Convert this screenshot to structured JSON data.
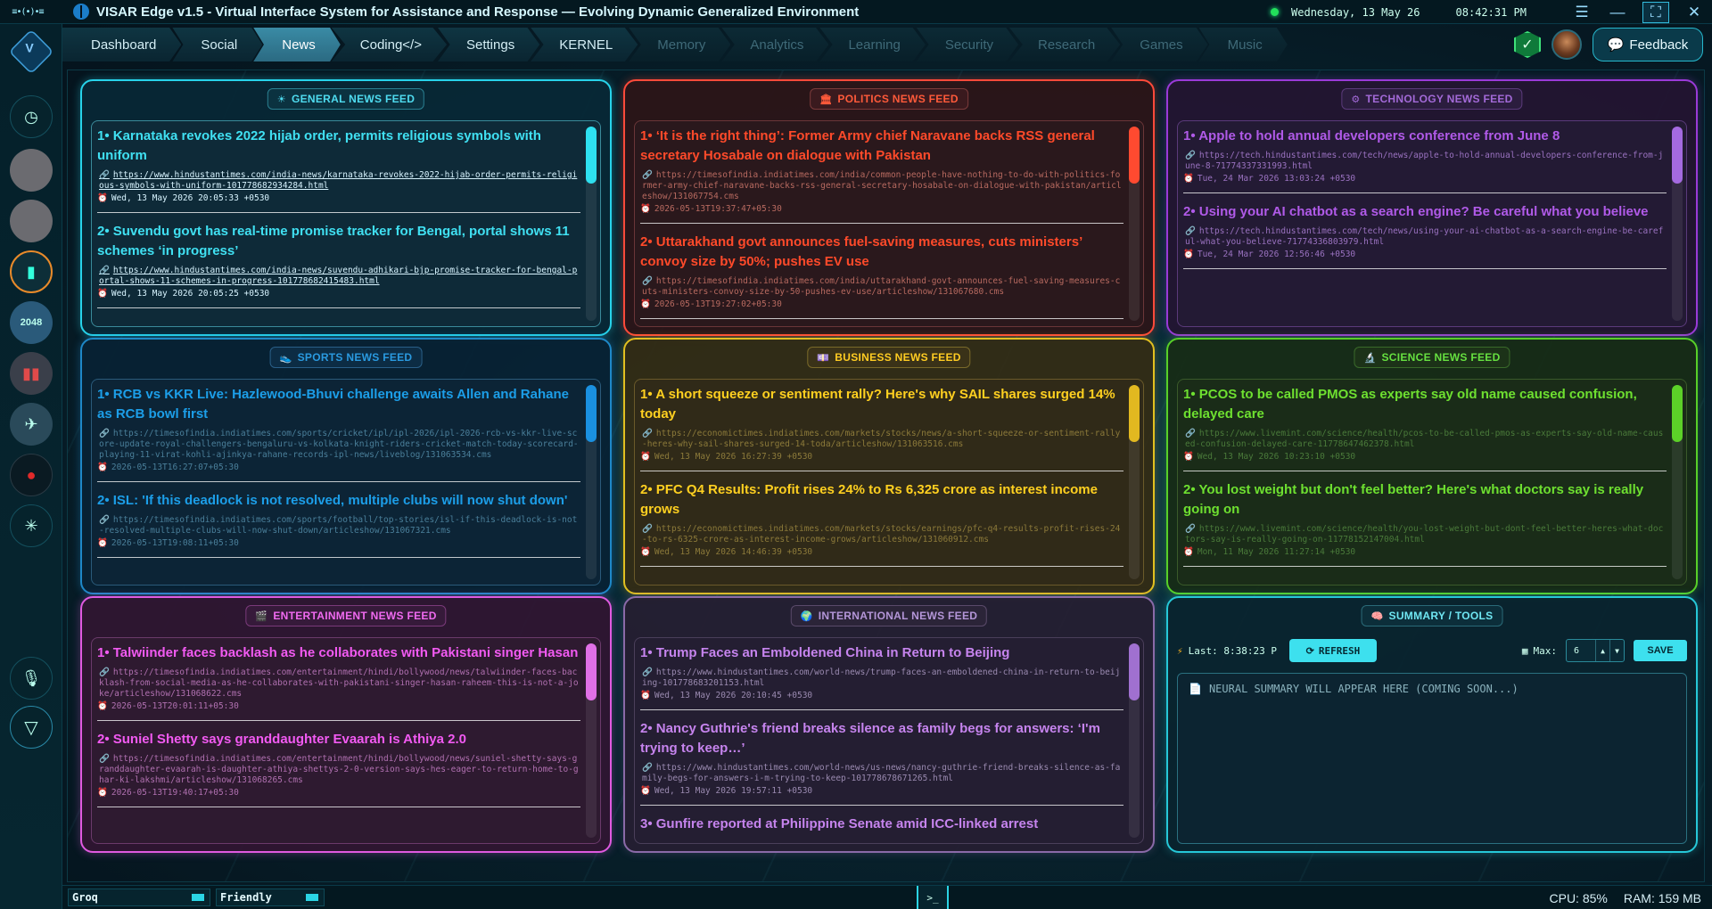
{
  "titlebar": {
    "logo": "≡•(•)•≡",
    "title": "VISAR Edge v1.5 - Virtual Interface System for Assistance and Response — Evolving Dynamic Generalized Environment",
    "date": "Wednesday, 13 May 26",
    "time": "08:42:31 PM"
  },
  "nav": {
    "tabs": [
      {
        "label": "Dashboard"
      },
      {
        "label": "Social"
      },
      {
        "label": "News"
      },
      {
        "label": "Coding</>"
      },
      {
        "label": "Settings"
      },
      {
        "label": "KERNEL"
      },
      {
        "label": "Memory"
      },
      {
        "label": "Analytics"
      },
      {
        "label": "Learning"
      },
      {
        "label": "Security"
      },
      {
        "label": "Research"
      },
      {
        "label": "Games"
      },
      {
        "label": "Music"
      }
    ],
    "active": "News",
    "feedback": "Feedback"
  },
  "feeds": {
    "general": {
      "title": "GENERAL NEWS FEED",
      "icon": "sun-icon",
      "items": [
        {
          "title": "1• Karnataka revokes 2022 hijab order, permits religious symbols with uniform",
          "url": "https://www.hindustantimes.com/india-news/karnataka-revokes-2022-hijab-order-permits-religious-symbols-with-uniform-101778682934284.html",
          "date": "Wed, 13 May 2026 20:05:33 +0530"
        },
        {
          "title": "2• Suvendu govt has real-time promise tracker for Bengal, portal shows 11 schemes ‘in progress’",
          "url": "https://www.hindustantimes.com/india-news/suvendu-adhikari-bjp-promise-tracker-for-bengal-portal-shows-11-schemes-in-progress-101778682415483.html",
          "date": "Wed, 13 May 2026 20:05:25 +0530"
        }
      ]
    },
    "politics": {
      "title": "POLITICS NEWS FEED",
      "icon": "building-icon",
      "items": [
        {
          "title": "1• ‘It is the right thing’: Former Army chief Naravane backs RSS general secretary Hosabale on dialogue with Pakistan",
          "url": "https://timesofindia.indiatimes.com/india/common-people-have-nothing-to-do-with-politics-former-army-chief-naravane-backs-rss-general-secretary-hosabale-on-dialogue-with-pakistan/articleshow/131067754.cms",
          "date": "2026-05-13T19:37:47+05:30"
        },
        {
          "title": "2• Uttarakhand govt announces fuel-saving measures, cuts ministers’ convoy size by 50%; pushes EV use",
          "url": "https://timesofindia.indiatimes.com/india/uttarakhand-govt-announces-fuel-saving-measures-cuts-ministers-convoy-size-by-50-pushes-ev-use/articleshow/131067680.cms",
          "date": "2026-05-13T19:27:02+05:30"
        }
      ]
    },
    "technology": {
      "title": "TECHNOLOGY NEWS FEED",
      "icon": "gear-icon",
      "items": [
        {
          "title": "1• Apple to hold annual developers conference from June 8",
          "url": "https://tech.hindustantimes.com/tech/news/apple-to-hold-annual-developers-conference-from-june-8-71774337331993.html",
          "date": "Tue, 24 Mar 2026 13:03:24 +0530"
        },
        {
          "title": "2• Using your AI chatbot as a search engine? Be careful what you believe",
          "url": "https://tech.hindustantimes.com/tech/news/using-your-ai-chatbot-as-a-search-engine-be-careful-what-you-believe-71774336803979.html",
          "date": "Tue, 24 Mar 2026 12:56:46 +0530"
        }
      ]
    },
    "sports": {
      "title": "SPORTS NEWS FEED",
      "icon": "shoe-icon",
      "items": [
        {
          "title": "1• RCB vs KKR Live: Hazlewood-Bhuvi challenge awaits Allen and Rahane as RCB bowl first",
          "url": "https://timesofindia.indiatimes.com/sports/cricket/ipl/ipl-2026/ipl-2026-rcb-vs-kkr-live-score-update-royal-challengers-bengaluru-vs-kolkata-knight-riders-cricket-match-today-scorecard-playing-11-virat-kohli-ajinkya-rahane-records-ipl-news/liveblog/131063534.cms",
          "date": "2026-05-13T16:27:07+05:30"
        },
        {
          "title": "2• ISL: 'If this deadlock is not resolved, multiple clubs will now shut down'",
          "url": "https://timesofindia.indiatimes.com/sports/football/top-stories/isl-if-this-deadlock-is-not-resolved-multiple-clubs-will-now-shut-down/articleshow/131067321.cms",
          "date": "2026-05-13T19:08:11+05:30"
        }
      ]
    },
    "business": {
      "title": "BUSINESS NEWS FEED",
      "icon": "money-icon",
      "items": [
        {
          "title": "1• A short squeeze or sentiment rally? Here's why SAIL shares surged 14% today",
          "url": "https://economictimes.indiatimes.com/markets/stocks/news/a-short-squeeze-or-sentiment-rally-heres-why-sail-shares-surged-14-toda/articleshow/131063516.cms",
          "date": "Wed, 13 May 2026 16:27:39 +0530"
        },
        {
          "title": "2• PFC Q4 Results: Profit rises 24% to Rs 6,325 crore as interest income grows",
          "url": "https://economictimes.indiatimes.com/markets/stocks/earnings/pfc-q4-results-profit-rises-24-to-rs-6325-crore-as-interest-income-grows/articleshow/131060912.cms",
          "date": "Wed, 13 May 2026 14:46:39 +0530"
        }
      ]
    },
    "science": {
      "title": "SCIENCE NEWS FEED",
      "icon": "microscope-icon",
      "items": [
        {
          "title": "1• PCOS to be called PMOS as experts say old name caused confusion, delayed care",
          "url": "https://www.livemint.com/science/health/pcos-to-be-called-pmos-as-experts-say-old-name-caused-confusion-delayed-care-11778647462378.html",
          "date": "Wed, 13 May 2026 10:23:10 +0530"
        },
        {
          "title": "2• You lost weight but don't feel better? Here's what doctors say is really going on",
          "url": "https://www.livemint.com/science/health/you-lost-weight-but-dont-feel-better-heres-what-doctors-say-is-really-going-on-11778152147004.html",
          "date": "Mon, 11 May 2026 11:27:14 +0530"
        }
      ]
    },
    "entertainment": {
      "title": "ENTERTAINMENT NEWS FEED",
      "icon": "film-icon",
      "items": [
        {
          "title": "1• Talwiinder faces backlash as he collaborates with Pakistani singer Hasan",
          "url": "https://timesofindia.indiatimes.com/entertainment/hindi/bollywood/news/talwiinder-faces-backlash-from-social-media-as-he-collaborates-with-pakistani-singer-hasan-raheem-this-is-not-a-joke/articleshow/131068622.cms",
          "date": "2026-05-13T20:01:11+05:30"
        },
        {
          "title": "2• Suniel Shetty says granddaughter Evaarah is Athiya 2.0",
          "url": "https://timesofindia.indiatimes.com/entertainment/hindi/bollywood/news/suniel-shetty-says-granddaughter-evaarah-is-daughter-athiya-shettys-2-0-version-says-hes-eager-to-return-home-to-ghar-ki-lakshmi/articleshow/131068265.cms",
          "date": "2026-05-13T19:40:17+05:30"
        }
      ]
    },
    "international": {
      "title": "INTERNATIONAL NEWS FEED",
      "icon": "globe-icon",
      "items": [
        {
          "title": "1• Trump Faces an Emboldened China in Return to Beijing",
          "url": "https://www.hindustantimes.com/world-news/trump-faces-an-emboldened-china-in-return-to-beijing-101778683201153.html",
          "date": "Wed, 13 May 2026 20:10:45 +0530"
        },
        {
          "title": "2• Nancy Guthrie's friend breaks silence as family begs for answers: ‘I'm trying to keep…’",
          "url": "https://www.hindustantimes.com/world-news/us-news/nancy-guthrie-friend-breaks-silence-as-family-begs-for-answers-i-m-trying-to-keep-101778678671265.html",
          "date": "Wed, 13 May 2026 19:57:11 +0530"
        },
        {
          "title": "3• Gunfire reported at Philippine Senate amid ICC-linked arrest",
          "url": "",
          "date": ""
        }
      ]
    }
  },
  "summary": {
    "title": "SUMMARY / TOOLS",
    "last_label": "Last: 8:38:23 P",
    "refresh_label": "REFRESH",
    "max_label": "Max:",
    "max_value": "6",
    "save_label": "SAVE",
    "placeholder": "NEURAL SUMMARY WILL APPEAR HERE (COMING SOON...)"
  },
  "statusbar": {
    "model": "Groq",
    "persona": "Friendly",
    "terminal": ">_",
    "cpu": "CPU: 85%",
    "ram": "RAM: 159 MB"
  },
  "theme": {
    "accent": "#27d3ea",
    "politics": "#ff4a3a",
    "technology": "#9a3ad8",
    "sports": "#1e88c8",
    "business": "#e2c020",
    "science": "#58d028",
    "entertainment": "#e05ae0",
    "international": "#8a6aa8"
  }
}
